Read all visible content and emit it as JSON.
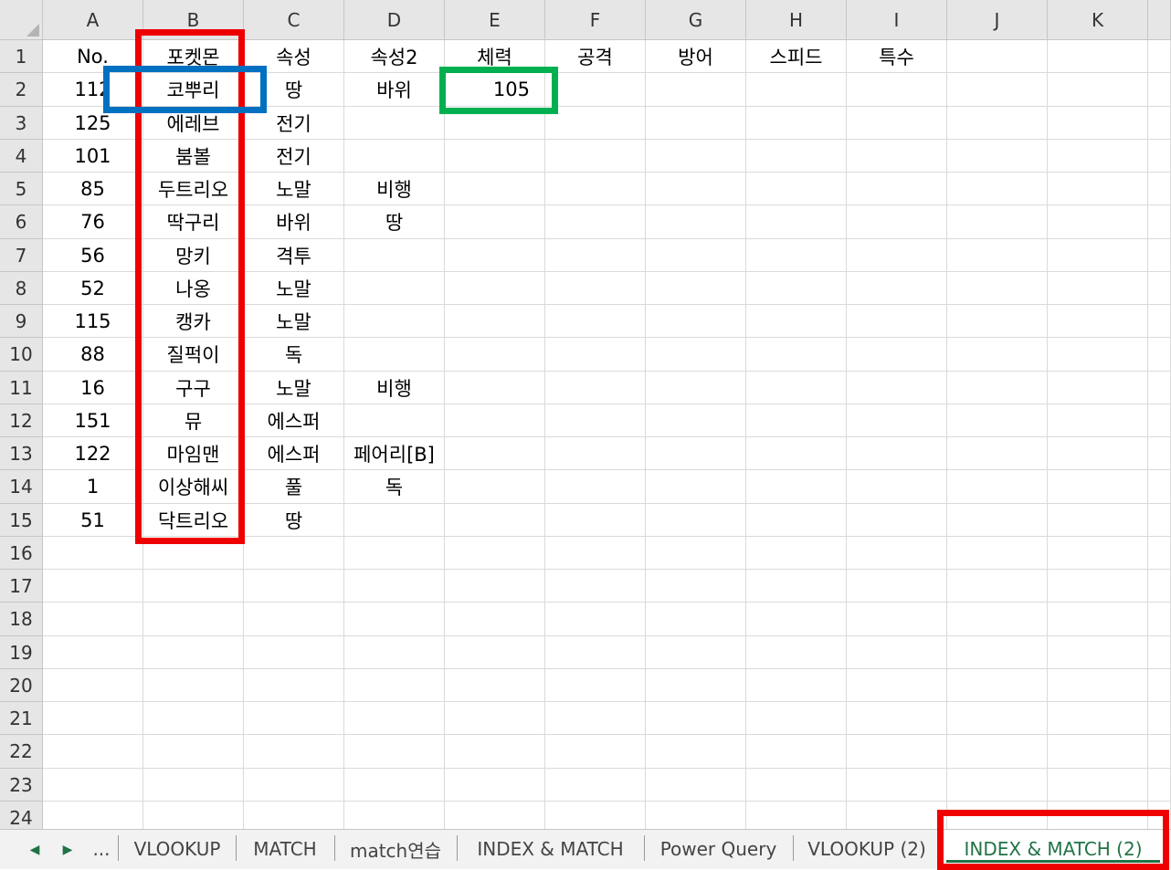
{
  "columns": [
    "A",
    "B",
    "C",
    "D",
    "E",
    "F",
    "G",
    "H",
    "I",
    "J",
    "K"
  ],
  "rows": [
    "1",
    "2",
    "3",
    "4",
    "5",
    "6",
    "7",
    "8",
    "9",
    "10",
    "11",
    "12",
    "13",
    "14",
    "15",
    "16",
    "17",
    "18",
    "19",
    "20",
    "21",
    "22",
    "23",
    "24"
  ],
  "header_row": [
    "No.",
    "포켓몬",
    "속성",
    "속성2",
    "체력",
    "공격",
    "방어",
    "스피드",
    "특수",
    "",
    ""
  ],
  "data_rows": [
    [
      "112",
      "코뿌리",
      "땅",
      "바위",
      "105"
    ],
    [
      "125",
      "에레브",
      "전기",
      "",
      ""
    ],
    [
      "101",
      "붐볼",
      "전기",
      "",
      ""
    ],
    [
      "85",
      "두트리오",
      "노말",
      "비행",
      ""
    ],
    [
      "76",
      "딱구리",
      "바위",
      "땅",
      ""
    ],
    [
      "56",
      "망키",
      "격투",
      "",
      ""
    ],
    [
      "52",
      "나옹",
      "노말",
      "",
      ""
    ],
    [
      "115",
      "캥카",
      "노말",
      "",
      ""
    ],
    [
      "88",
      "질퍽이",
      "독",
      "",
      ""
    ],
    [
      "16",
      "구구",
      "노말",
      "비행",
      ""
    ],
    [
      "151",
      "뮤",
      "에스퍼",
      "",
      ""
    ],
    [
      "122",
      "마임맨",
      "에스퍼",
      "페어리[B]",
      ""
    ],
    [
      "1",
      "이상해씨",
      "풀",
      "독",
      ""
    ],
    [
      "51",
      "닥트리오",
      "땅",
      "",
      ""
    ]
  ],
  "tabs": {
    "nav_prev": "◀",
    "nav_next": "▶",
    "more": "...",
    "sheets": [
      "VLOOKUP",
      "MATCH",
      "match연습",
      "INDEX & MATCH",
      "Power Query",
      "VLOOKUP (2)",
      "INDEX & MATCH (2)"
    ],
    "active_index": 6
  },
  "colors": {
    "highlight_red": "#ee0000",
    "highlight_blue": "#0070c0",
    "highlight_green": "#00b050",
    "active_tab": "#217346"
  }
}
